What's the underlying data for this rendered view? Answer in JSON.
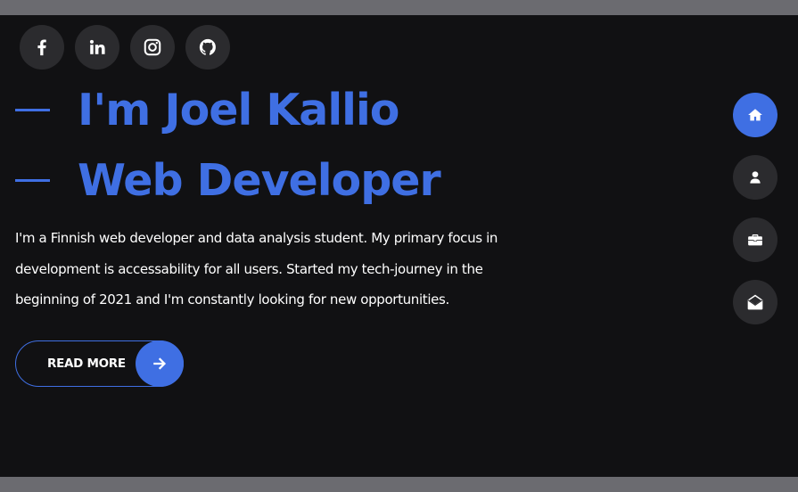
{
  "social": {
    "items": [
      {
        "name": "facebook",
        "icon": "facebook-icon"
      },
      {
        "name": "linkedin",
        "icon": "linkedin-icon"
      },
      {
        "name": "instagram",
        "icon": "instagram-icon"
      },
      {
        "name": "github",
        "icon": "github-icon"
      }
    ]
  },
  "hero": {
    "line1": "I'm Joel Kallio",
    "line2": "Web Developer",
    "intro": "I'm a Finnish web developer and data analysis student. My primary focus in development is accessability for all users. Started my tech-journey in the beginning of 2021 and I'm constantly looking for new opportunities.",
    "button_label": "READ MORE",
    "button_icon": "arrow-right-icon"
  },
  "side_nav": {
    "items": [
      {
        "name": "home",
        "icon": "home-icon",
        "active": true
      },
      {
        "name": "about",
        "icon": "user-icon",
        "active": false
      },
      {
        "name": "portfolio",
        "icon": "briefcase-icon",
        "active": false
      },
      {
        "name": "contact",
        "icon": "envelope-open-icon",
        "active": false
      }
    ]
  },
  "colors": {
    "accent": "#3f6fe3",
    "background": "#111113",
    "outer_background": "#6b6b70",
    "icon_circle": "#2b2b2e",
    "text": "#ffffff"
  }
}
